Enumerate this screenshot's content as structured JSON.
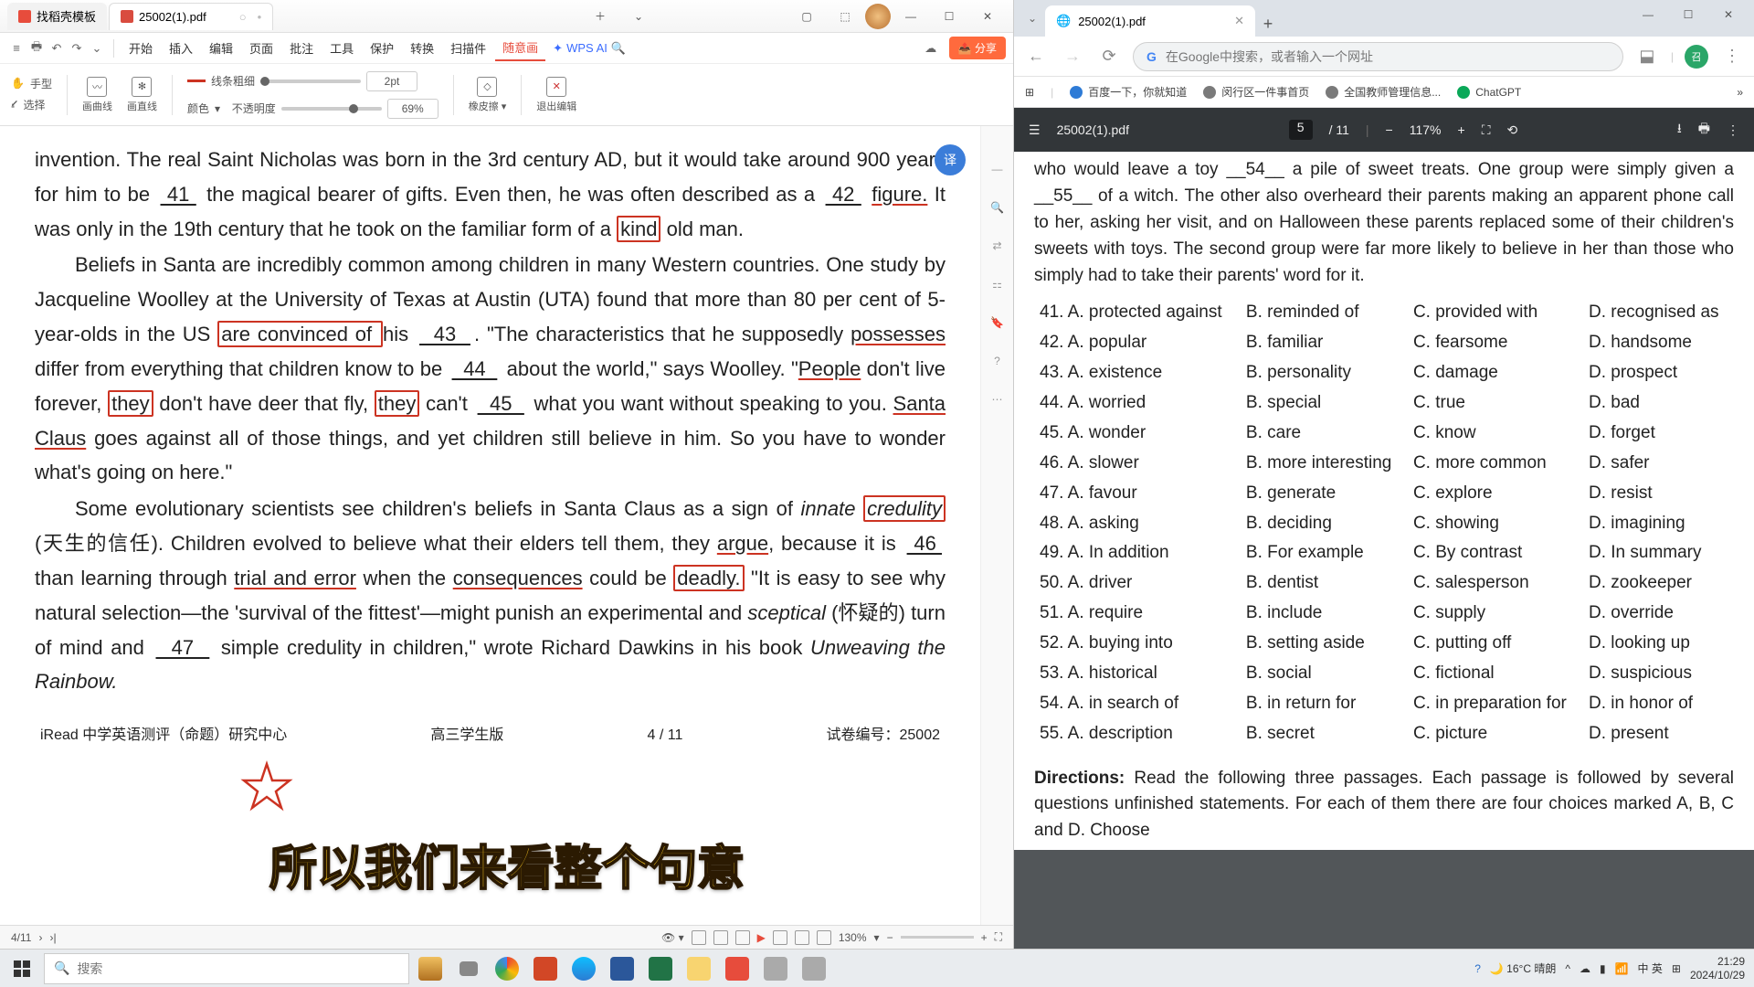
{
  "wps": {
    "tabs": [
      {
        "icon": "orange",
        "label": "找稻壳模板"
      },
      {
        "icon": "pdf",
        "label": "25002(1).pdf"
      }
    ],
    "ribbon_left_icons": [
      "menu-icon",
      "new-icon",
      "undo-icon",
      "redo-icon",
      "dropdown-icon"
    ],
    "menus": [
      "开始",
      "插入",
      "编辑",
      "页面",
      "批注",
      "工具",
      "保护",
      "转换",
      "扫描件",
      "随意画"
    ],
    "wpsai": "WPS AI",
    "share": "分享",
    "tools": {
      "hand": "手型",
      "select": "选择",
      "curve": "画曲线",
      "line": "画直线",
      "color": "颜色",
      "line_weight": "线条粗细",
      "opacity": "不透明度",
      "val_pt": "2pt",
      "val_pct": "69%",
      "eraser": "橡皮擦",
      "exit": "退出编辑"
    },
    "doc": {
      "p1": "invention. The real Saint Nicholas was born in the 3rd century AD, but it would take around 900 years for him to be __41__ the magical bearer of gifts. Even then, he was often described as a __42 figure. It was only in the 19th century that he took on the familiar form of a kind old man.",
      "p2": "Beliefs in Santa are incredibly common among children in many Western countries. One study by Jacqueline Woolley at the University of Texas at Austin (UTA) found that more than 80 per cent of 5-year-olds in the US are convinced of his __43__. \"The characteristics that he supposedly possesses differ from everything that children know to be __44__ about the world,\" says Woolley. \"People don't live forever, they don't have deer that fly, they can't __45__ what you want without speaking to you. Santa Claus goes against all of those things, and yet children still believe in him. So you have to wonder what's going on here.\"",
      "p3": "Some evolutionary scientists see children's beliefs in Santa Claus as a sign of innate credulity (天生的信任). Children evolved to believe what their elders tell them, they argue, because it is __46 than learning through trial and error when the consequences could be deadly. \"It is easy to see why natural selection—the 'survival of the fittest'—might punish an experimental and sceptical (怀疑的) turn of mind and __47__ simple credulity in children,\" wrote Richard Dawkins in his book Unweaving the Rainbow.",
      "footer_left": "iRead 中学英语测评（命题）研究中心",
      "footer_mid": "高三学生版",
      "footer_page": "4 / 11",
      "footer_id": "试卷编号：25002"
    },
    "status": {
      "page": "4/11",
      "zoom": "130%"
    },
    "subtitle": "所以我们来看整个句意"
  },
  "chrome": {
    "tab_title": "25002(1).pdf",
    "omnibox": "在Google中搜索，或者输入一个网址",
    "profile": "召",
    "bookmarks": [
      {
        "i": "",
        "label": ""
      },
      {
        "i": "blue",
        "label": "百度一下，你就知道"
      },
      {
        "i": "gray",
        "label": "闵行区一件事首页"
      },
      {
        "i": "gray",
        "label": "全国教师管理信息..."
      },
      {
        "i": "green",
        "label": "ChatGPT"
      }
    ],
    "pdf": {
      "title": "25002(1).pdf",
      "page": "5",
      "total": "/ 11",
      "zoom": "117%",
      "top": "who would leave a toy __54__ a pile of sweet treats. One group were simply given a __55__ of a witch. The other also overheard their parents making an apparent phone call to her, asking her visit, and on Halloween these parents replaced some of their children's sweets with toys. The second group were far more likely to believe in her than those who simply had to take their parents' word for it.",
      "answers": [
        [
          "41. A. protected against",
          "B. reminded of",
          "C. provided with",
          "D. recognised as"
        ],
        [
          "42. A. popular",
          "B. familiar",
          "C. fearsome",
          "D. handsome"
        ],
        [
          "43. A. existence",
          "B. personality",
          "C. damage",
          "D. prospect"
        ],
        [
          "44. A. worried",
          "B. special",
          "C. true",
          "D. bad"
        ],
        [
          "45. A. wonder",
          "B. care",
          "C. know",
          "D. forget"
        ],
        [
          "46. A. slower",
          "B. more interesting",
          "C. more common",
          "D. safer"
        ],
        [
          "47. A. favour",
          "B. generate",
          "C. explore",
          "D. resist"
        ],
        [
          "48. A. asking",
          "B. deciding",
          "C. showing",
          "D. imagining"
        ],
        [
          "49. A. In addition",
          "B. For example",
          "C. By contrast",
          "D. In summary"
        ],
        [
          "50. A. driver",
          "B. dentist",
          "C. salesperson",
          "D. zookeeper"
        ],
        [
          "51. A. require",
          "B. include",
          "C. supply",
          "D. override"
        ],
        [
          "52. A. buying into",
          "B. setting aside",
          "C. putting off",
          "D. looking up"
        ],
        [
          "53. A. historical",
          "B. social",
          "C. fictional",
          "D. suspicious"
        ],
        [
          "54. A. in search of",
          "B. in return for",
          "C. in preparation for",
          "D. in honor of"
        ],
        [
          "55. A. description",
          "B. secret",
          "C. picture",
          "D. present"
        ]
      ],
      "directions_label": "Directions:",
      "directions": " Read the following three passages.  Each passage is followed by several questions unfinished statements. For each of them there are four choices marked A, B, C and D. Choose"
    }
  },
  "taskbar": {
    "search": "搜索",
    "weather": "16°C 晴朗",
    "ime": "中 英",
    "time": "21:29",
    "date": "2024/10/29"
  }
}
